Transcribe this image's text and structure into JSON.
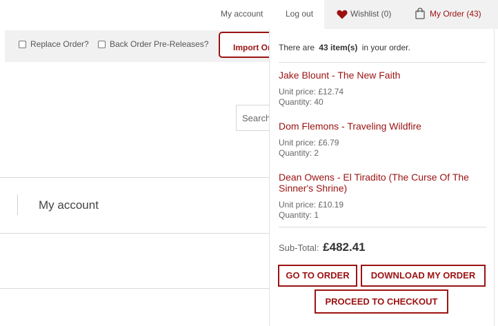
{
  "nav": {
    "my_account": "My account",
    "log_out": "Log out",
    "wishlist": "Wishlist (0)",
    "my_order": "My Order (43)"
  },
  "toolbar": {
    "replace_order": "Replace Order?",
    "back_order": "Back Order Pre-Releases?",
    "import_button": "Import Or"
  },
  "search": {
    "placeholder": "Search"
  },
  "account": {
    "title": "My account"
  },
  "cart": {
    "summary_prefix": "There are",
    "summary_count": "43 item(s)",
    "summary_suffix": "in your order.",
    "items": [
      {
        "title": "Jake Blount - The New Faith",
        "unit_price": "Unit price: £12.74",
        "quantity": "Quantity: 40"
      },
      {
        "title": "Dom Flemons - Traveling Wildfire",
        "unit_price": "Unit price: £6.79",
        "quantity": "Quantity: 2"
      },
      {
        "title": "Dean Owens - El Tiradito (The Curse Of The Sinner's Shrine)",
        "unit_price": "Unit price: £10.19",
        "quantity": "Quantity: 1"
      }
    ],
    "subtotal_label": "Sub-Total:",
    "subtotal_value": "£482.41",
    "go_to_order": "GO TO ORDER",
    "download": "DOWNLOAD MY ORDER",
    "checkout": "PROCEED TO CHECKOUT"
  },
  "colors": {
    "accent": "#9b1111",
    "panel_bg": "#f1f1f1"
  },
  "icons": {
    "wishlist": "heart-icon",
    "order": "shopping-bag-icon"
  }
}
